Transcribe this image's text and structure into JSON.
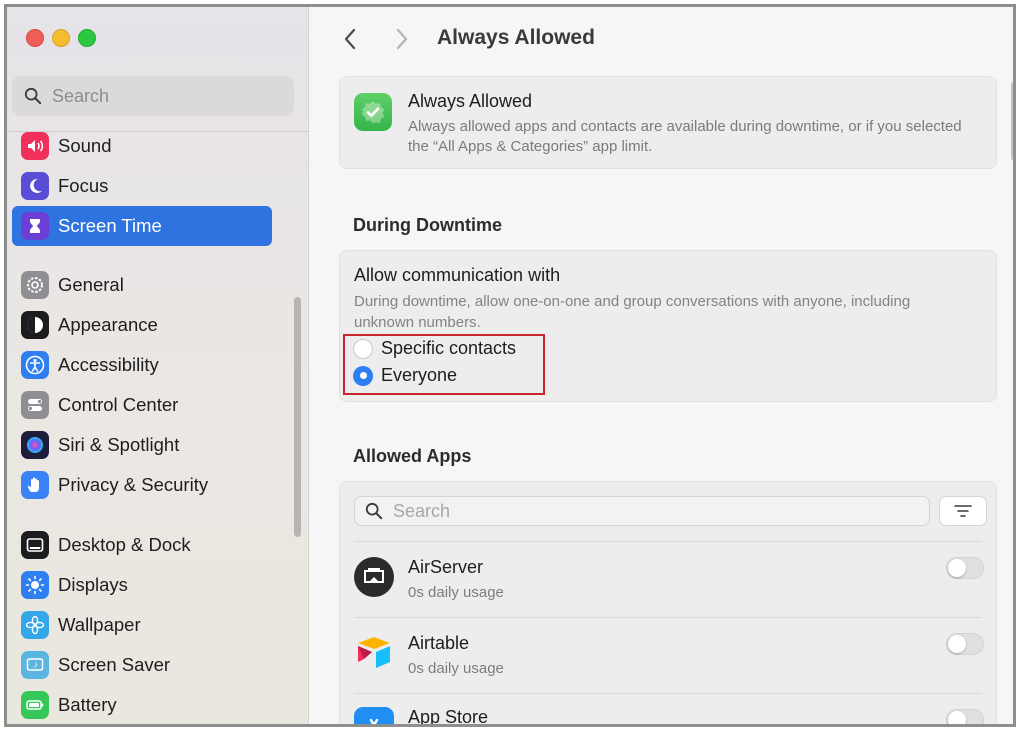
{
  "window": {
    "title": "Always Allowed"
  },
  "sidebar": {
    "search_placeholder": "Search",
    "items": [
      {
        "label": "Sound",
        "icon": "speaker-icon",
        "color": "#f0305a"
      },
      {
        "label": "Focus",
        "icon": "moon-icon",
        "color": "#5b4ed6"
      },
      {
        "label": "Screen Time",
        "icon": "hourglass-icon",
        "color": "#6b3fd6",
        "selected": true
      },
      {
        "label": "General",
        "icon": "gear-icon",
        "color": "#8e8e93"
      },
      {
        "label": "Appearance",
        "icon": "appearance-icon",
        "color": "#1c1c1e"
      },
      {
        "label": "Accessibility",
        "icon": "accessibility-icon",
        "color": "#2f7ff0"
      },
      {
        "label": "Control Center",
        "icon": "toggles-icon",
        "color": "#8e8e93"
      },
      {
        "label": "Siri & Spotlight",
        "icon": "siri-icon",
        "color": "#2b2b6e"
      },
      {
        "label": "Privacy & Security",
        "icon": "hand-icon",
        "color": "#3b82f6"
      },
      {
        "label": "Desktop & Dock",
        "icon": "dock-icon",
        "color": "#1c1c1e"
      },
      {
        "label": "Displays",
        "icon": "sun-icon",
        "color": "#2f7ff0"
      },
      {
        "label": "Wallpaper",
        "icon": "flower-icon",
        "color": "#35a7e8"
      },
      {
        "label": "Screen Saver",
        "icon": "screensaver-icon",
        "color": "#5ab5e0"
      },
      {
        "label": "Battery",
        "icon": "battery-icon",
        "color": "#35c759"
      }
    ]
  },
  "header": {
    "back_icon": "chevron-left-icon",
    "forward_icon": "chevron-right-icon",
    "title": "Always Allowed"
  },
  "always_allowed_card": {
    "title": "Always Allowed",
    "description": "Always allowed apps and contacts are available during downtime, or if you selected the “All Apps & Categories” app limit."
  },
  "downtime": {
    "section_title": "During Downtime",
    "comm_title": "Allow communication with",
    "comm_description": "During downtime, allow one-on-one and group conversations with anyone, including unknown numbers.",
    "options": [
      {
        "label": "Specific contacts",
        "selected": false
      },
      {
        "label": "Everyone",
        "selected": true
      }
    ],
    "highlight_color": "#c8262c"
  },
  "allowed_apps": {
    "section_title": "Allowed Apps",
    "search_placeholder": "Search",
    "apps": [
      {
        "name": "AirServer",
        "usage": "0s daily usage",
        "enabled": false
      },
      {
        "name": "Airtable",
        "usage": "0s daily usage",
        "enabled": false
      },
      {
        "name": "App Store",
        "usage": "",
        "enabled": false
      }
    ]
  },
  "colors": {
    "accent": "#2f73e0",
    "radio_on": "#2d7ff0"
  }
}
